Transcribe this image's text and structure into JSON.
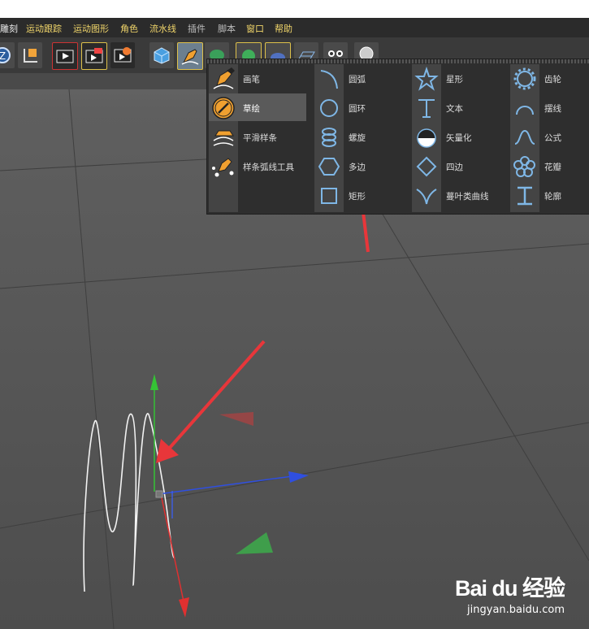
{
  "menubar": {
    "items": [
      {
        "label": "雕刻",
        "style": "normal"
      },
      {
        "label": "运动跟踪",
        "style": "hl"
      },
      {
        "label": "运动图形",
        "style": "hl"
      },
      {
        "label": "角色",
        "style": "hl"
      },
      {
        "label": "流水线",
        "style": "hl"
      },
      {
        "label": "插件",
        "style": "dim"
      },
      {
        "label": "脚本",
        "style": "dim"
      },
      {
        "label": "窗口",
        "style": "hl"
      },
      {
        "label": "帮助",
        "style": "hl"
      }
    ]
  },
  "toolbar": {
    "buttons": [
      "rotate-icon",
      "axis-icon",
      "render-view-icon",
      "render-active-icon",
      "render-settings-icon",
      "cube-icon",
      "pen-icon",
      "deformer-icon",
      "generator-icon",
      "environment-icon",
      "floor-icon",
      "camera-icon",
      "light-icon"
    ]
  },
  "spline_menu": {
    "col1": [
      {
        "label": "画笔",
        "icon": "pen-icon"
      },
      {
        "label": "草绘",
        "icon": "sketch-icon",
        "selected": true
      },
      {
        "label": "平滑样条",
        "icon": "smooth-spline-icon"
      },
      {
        "label": "样条弧线工具",
        "icon": "spline-arc-tool-icon"
      }
    ],
    "col2": [
      {
        "label": "圆弧",
        "icon": "arc-icon"
      },
      {
        "label": "圆环",
        "icon": "circle-icon"
      },
      {
        "label": "螺旋",
        "icon": "helix-icon"
      },
      {
        "label": "多边",
        "icon": "polygon-icon"
      },
      {
        "label": "矩形",
        "icon": "rectangle-icon"
      }
    ],
    "col3": [
      {
        "label": "星形",
        "icon": "star-icon"
      },
      {
        "label": "文本",
        "icon": "text-icon"
      },
      {
        "label": "矢量化",
        "icon": "vectorizer-icon"
      },
      {
        "label": "四边",
        "icon": "four-side-icon"
      },
      {
        "label": "蔓叶类曲线",
        "icon": "cissoid-icon"
      }
    ],
    "col4": [
      {
        "label": "齿轮",
        "icon": "cogwheel-icon"
      },
      {
        "label": "摆线",
        "icon": "cycloid-icon"
      },
      {
        "label": "公式",
        "icon": "formula-icon"
      },
      {
        "label": "花瓣",
        "icon": "flower-icon"
      },
      {
        "label": "轮廓",
        "icon": "profile-icon"
      }
    ]
  },
  "watermark": {
    "brand": "Bai du 经验",
    "url": "jingyan.baidu.com"
  },
  "colors": {
    "accent": "#f0d56a",
    "icon_blue": "#7fb7e6",
    "annotation": "#e8363a"
  }
}
